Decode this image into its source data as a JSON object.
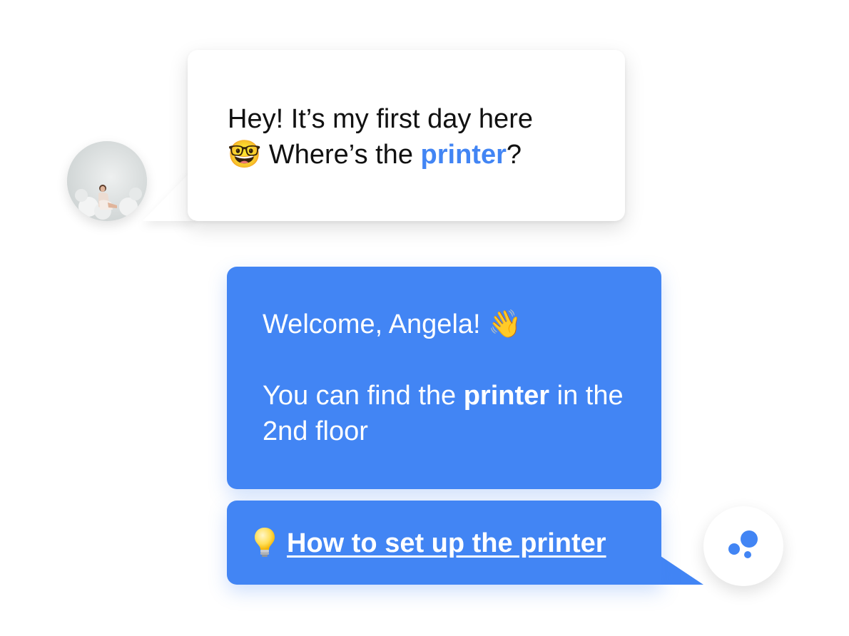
{
  "conversation": {
    "user_message": {
      "line1": "Hey! It’s my first day here",
      "emoji": "🤓",
      "line2_before": " Where’s the ",
      "line2_highlight": "printer",
      "line2_after": "?"
    },
    "bot_message": {
      "greeting": "Welcome, Angela!",
      "greeting_emoji": "👋",
      "answer_before": "You can find the ",
      "answer_bold": "printer",
      "answer_after": " in the 2nd floor"
    },
    "bot_suggestion": {
      "link_label": "How to set up the printer",
      "icon": "lightbulb-icon"
    }
  },
  "avatars": {
    "user": "user-avatar-photo",
    "bot": "bot-logo-icon"
  },
  "colors": {
    "accent": "#4285f4",
    "user_bubble": "#ffffff",
    "user_text": "#111111",
    "bot_text": "#ffffff"
  }
}
